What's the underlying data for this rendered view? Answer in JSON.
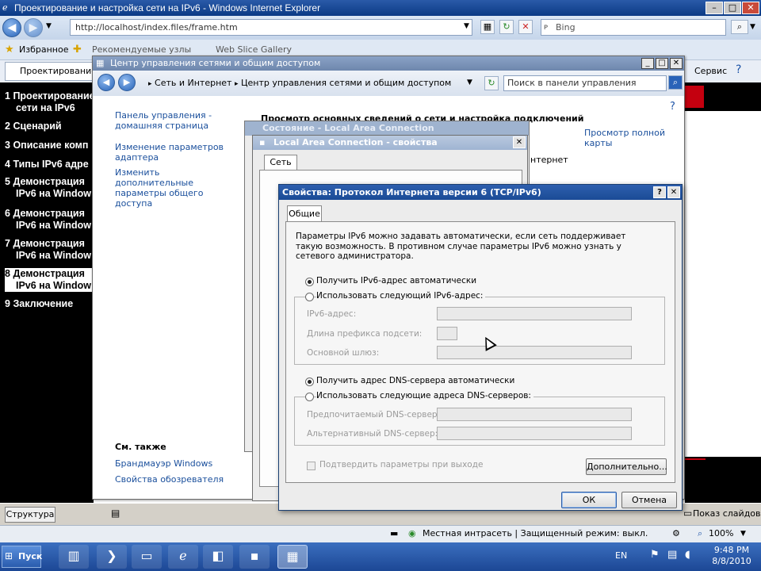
{
  "ie": {
    "title": "Проектирование и настройка сети на IPv6 - Windows Internet Explorer",
    "address": "http://localhost/index.files/frame.htm",
    "search_placeholder": "Bing",
    "favorites_label": "Избранное",
    "fav_items": [
      "Рекомендуемые узлы",
      "Web Slice Gallery"
    ],
    "tab_title": "Проектирование и настройка сети на IPv6",
    "service_menu": "Сервис",
    "status_zone": "Местная интрасеть | Защищенный режим: выкл.",
    "zoom": "100%"
  },
  "outline": {
    "items": [
      {
        "num": "1",
        "text": "Проектирование",
        "text2": "сети на IPv6"
      },
      {
        "num": "2",
        "text": "Сценарий"
      },
      {
        "num": "3",
        "text": "Описание комп"
      },
      {
        "num": "4",
        "text": "Типы IPv6 адре"
      },
      {
        "num": "5",
        "text": "Демонстрация",
        "text2": "IPv6 на Window"
      },
      {
        "num": "6",
        "text": "Демонстрация",
        "text2": "IPv6 на Window"
      },
      {
        "num": "7",
        "text": "Демонстрация",
        "text2": "IPv6 на Window"
      },
      {
        "num": "8",
        "text": "Демонстрация",
        "text2": "IPv6 на Window"
      },
      {
        "num": "9",
        "text": "Заключение"
      }
    ]
  },
  "viewer": {
    "structure_button": "Структура",
    "slideshow_label": "Показ слайдов"
  },
  "control_panel": {
    "title": "Центр управления сетями и общим доступом",
    "breadcrumb": [
      "Сеть и Интернет",
      "Центр управления сетями и общим доступом"
    ],
    "search_placeholder": "Поиск в панели управления",
    "sidebar_home": "Панель управления - домашняя страница",
    "sidebar_links": [
      "Изменение параметров адаптера",
      "Изменить дополнительные параметры общего доступа"
    ],
    "heading": "Просмотр основных сведений о сети и настройка подключений",
    "full_map": "Просмотр полной карты",
    "internet_label": "нтернет",
    "see_also": "См. также",
    "see_also_links": [
      "Брандмауэр Windows",
      "Свойства обозревателя"
    ]
  },
  "status_dialog": {
    "title": "Состояние - Local Area Connection"
  },
  "lac_dialog": {
    "title": "Local Area Connection - свойства",
    "tab": "Сеть"
  },
  "ipv6_dialog": {
    "title": "Свойства: Протокол Интернета версии 6 (TCP/IPv6)",
    "tab": "Общие",
    "description": "Параметры IPv6 можно задавать автоматически, если сеть поддерживает такую возможность. В противном случае параметры IPv6 можно узнать у сетевого администратора.",
    "radio_auto_ip": "Получить IPv6-адрес автоматически",
    "radio_manual_ip": "Использовать следующий IPv6-адрес:",
    "field_ip": "IPv6-адрес:",
    "field_prefix": "Длина префикса подсети:",
    "field_gateway": "Основной шлюз:",
    "radio_auto_dns": "Получить адрес DNS-сервера автоматически",
    "radio_manual_dns": "Использовать следующие адреса DNS-серверов:",
    "field_dns1": "Предпочитаемый DNS-сервер:",
    "field_dns2": "Альтернативный DNS-сервер:",
    "validate_label": "Подтвердить параметры при выходе",
    "advanced_button": "Дополнительно...",
    "ok_button": "ОК",
    "cancel_button": "Отмена"
  },
  "taskbar": {
    "start": "Пуск",
    "lang": "EN",
    "time": "9:48 PM",
    "date": "8/8/2010"
  }
}
